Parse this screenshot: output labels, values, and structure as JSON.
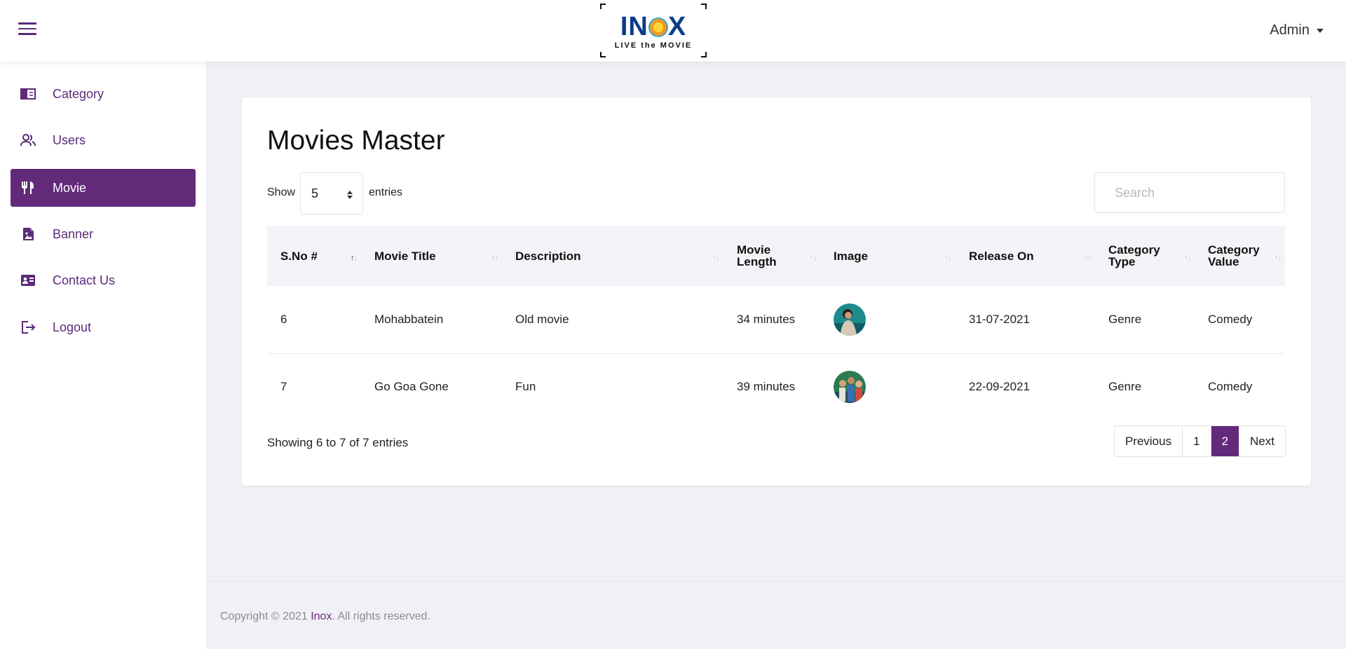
{
  "header": {
    "logo_word": "INOX",
    "logo_word_before_sun": "IN",
    "logo_word_after_sun": "X",
    "logo_tagline": "LIVE the MOVIE",
    "user_label": "Admin"
  },
  "sidebar": {
    "items": [
      {
        "label": "Category",
        "icon": "book-icon",
        "active": false
      },
      {
        "label": "Users",
        "icon": "users-icon",
        "active": false
      },
      {
        "label": "Movie",
        "icon": "utensils-icon",
        "active": true
      },
      {
        "label": "Banner",
        "icon": "image-file-icon",
        "active": false
      },
      {
        "label": "Contact Us",
        "icon": "contact-card-icon",
        "active": false
      },
      {
        "label": "Logout",
        "icon": "logout-icon",
        "active": false
      }
    ]
  },
  "main": {
    "title": "Movies Master",
    "show_label": "Show",
    "entries_value": "5",
    "entries_label": "entries",
    "search_placeholder": "Search",
    "columns": [
      {
        "line1": "S.No #",
        "line2": ""
      },
      {
        "line1": "Movie Title",
        "line2": ""
      },
      {
        "line1": "Description",
        "line2": ""
      },
      {
        "line1": "Movie",
        "line2": "Length"
      },
      {
        "line1": "Image",
        "line2": ""
      },
      {
        "line1": "Release On",
        "line2": ""
      },
      {
        "line1": "Category",
        "line2": "Type"
      },
      {
        "line1": "Category",
        "line2": "Value"
      }
    ],
    "sorted_column": "S.No #",
    "rows": [
      {
        "sno": "6",
        "title": "Mohabbatein",
        "description": "Old movie",
        "length": "34 minutes",
        "image": "movie-poster-thumbnail",
        "release": "31-07-2021",
        "cat_type": "Genre",
        "cat_value": "Comedy"
      },
      {
        "sno": "7",
        "title": "Go Goa Gone",
        "description": "Fun",
        "length": "39 minutes",
        "image": "movie-poster-thumbnail",
        "release": "22-09-2021",
        "cat_type": "Genre",
        "cat_value": "Comedy"
      }
    ],
    "info": "Showing 6 to 7 of 7 entries",
    "pager": {
      "previous": "Previous",
      "pages": [
        "1",
        "2"
      ],
      "current": "2",
      "next": "Next"
    }
  },
  "footer": {
    "prefix": "Copyright © 2021 ",
    "brand": "Inox",
    "suffix": ". All rights reserved."
  },
  "colors": {
    "accent": "#632a7a",
    "background": "#f0f1f6",
    "logo_blue": "#0c3b88"
  }
}
